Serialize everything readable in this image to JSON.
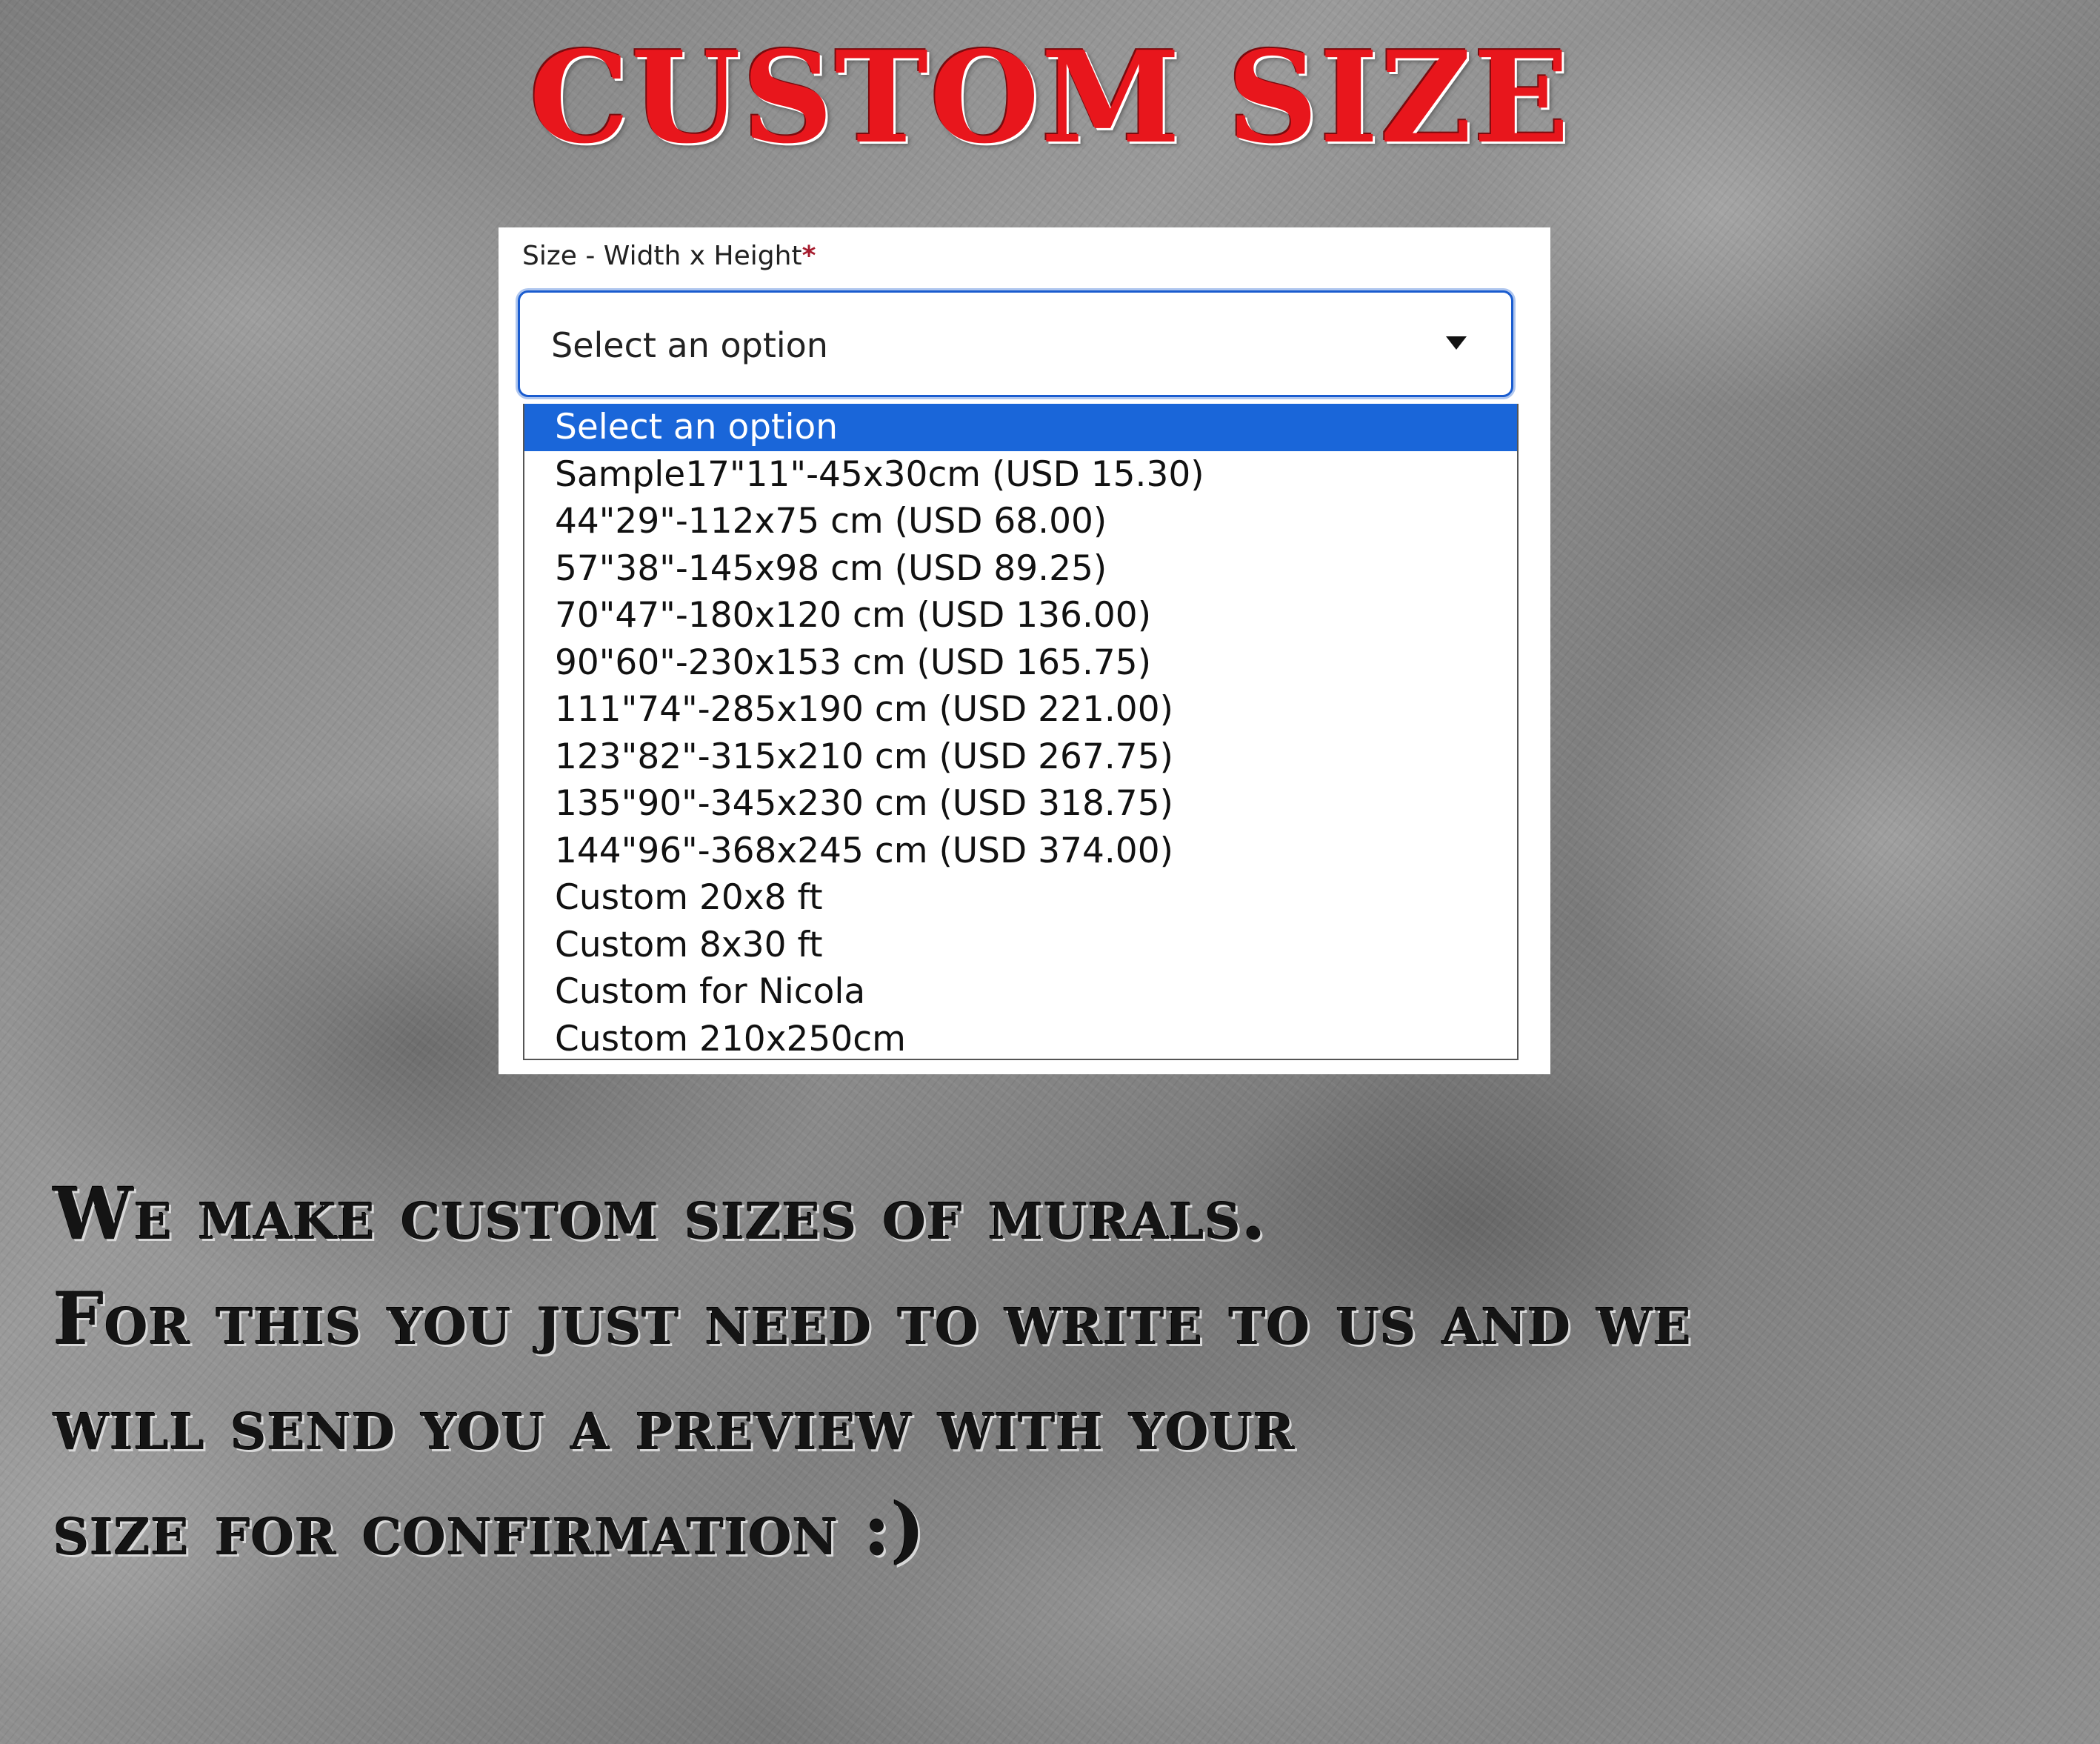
{
  "heading": "CUSTOM SIZE",
  "size_field": {
    "label": "Size - Width x Height",
    "required_mark": "*",
    "selected_value": "Select an option",
    "options": [
      "Select an option",
      "Sample17\"11\"-45x30cm (USD 15.30)",
      "44\"29\"-112x75 cm (USD 68.00)",
      "57\"38\"-145x98 cm (USD 89.25)",
      "70\"47\"-180x120 cm (USD 136.00)",
      "90\"60\"-230x153 cm (USD 165.75)",
      "111\"74\"-285x190 cm (USD 221.00)",
      "123\"82\"-315x210 cm (USD 267.75)",
      "135\"90\"-345x230 cm (USD 318.75)",
      "144\"96\"-368x245 cm (USD 374.00)",
      "Custom 20x8 ft",
      "Custom 8x30 ft",
      "Custom for Nicola",
      "Custom 210x250cm"
    ],
    "highlighted_index": 0
  },
  "message_lines": [
    "We make custom sizes of murals.",
    "For this you just need to write to us and we",
    "will send you a preview with your",
    "size for confirmation :)"
  ],
  "colors": {
    "heading": "#e8161c",
    "focus_border": "#1a5ccf",
    "highlight": "#1a66d9",
    "required": "#a61c2e"
  }
}
